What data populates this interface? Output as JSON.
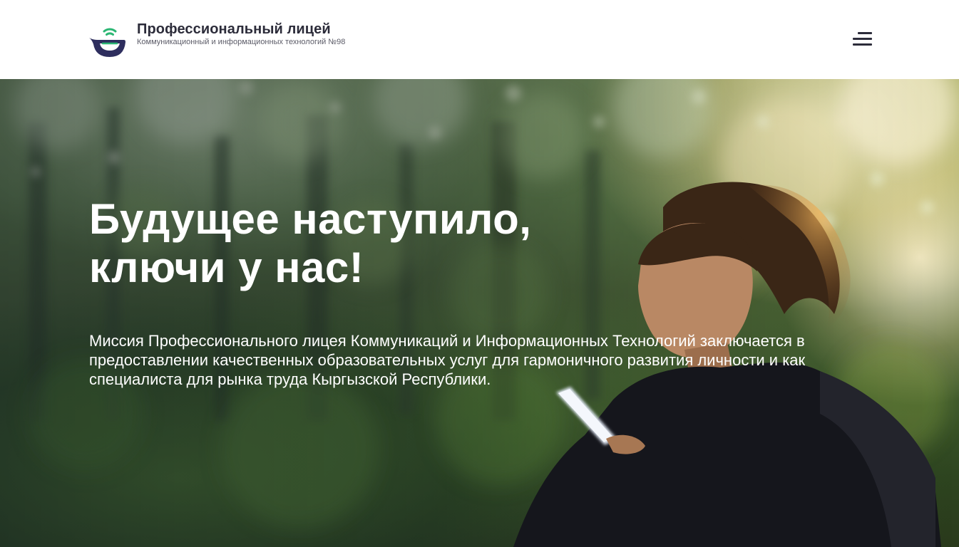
{
  "header": {
    "logo_title": "Профессиональный лицей",
    "logo_subtitle": "Коммуникационный и информационных технологий №98",
    "logo_icon": "lyceum-logo-icon",
    "menu_icon": "hamburger-menu-icon",
    "colors": {
      "logo_green": "#2bb673",
      "logo_navy": "#2e2e5e",
      "text_dark": "#2c2c3a"
    }
  },
  "hero": {
    "title_line_1": "Будущее наступило,",
    "title_line_2": "ключи у нас!",
    "mission_text": "Миссия Профессионального лицея Коммуникаций и Информационных Технологий заключается в предоставлении качественных образовательных услуг для гармоничного развития личности и как специалиста для рынка труда Кыргызской Республики."
  }
}
